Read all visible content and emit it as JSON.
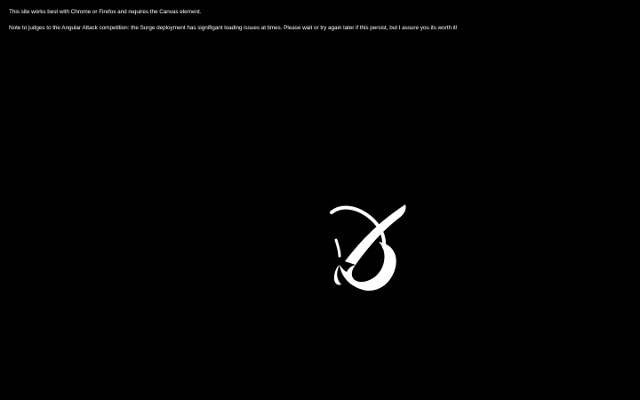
{
  "notices": {
    "browser_support": "This site works best with Chrome or Firefox and requires the Canvas element.",
    "judges_note": "Note to judges to the Angular Attack competition: the Surge deployment has signifigant loading issues at times. Please wait or try again later if this persist, but I assure you its worth it!"
  },
  "loader": {
    "icon": "swirl-logo-icon",
    "color": "#ffffff"
  },
  "colors": {
    "background": "#000000",
    "text": "#ffffff"
  }
}
